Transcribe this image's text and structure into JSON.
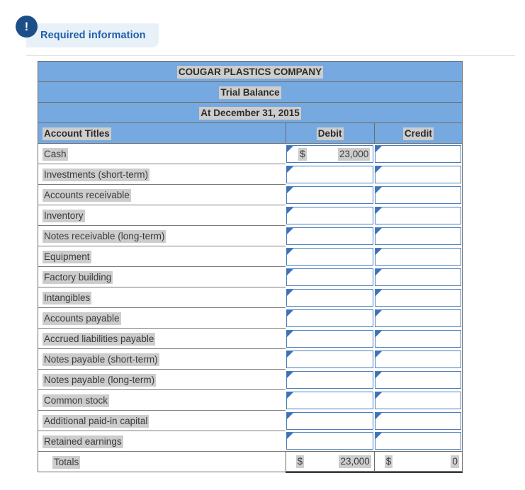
{
  "banner": {
    "icon": "exclamation-icon",
    "label": "Required information",
    "bg_color": "#e9f1f8",
    "text_color": "#1f5fa9",
    "icon_color": "#1c4e88"
  },
  "table": {
    "header_bg": "#76a9e0",
    "title_lines": [
      "COUGAR PLASTICS COMPANY",
      "Trial Balance",
      "At December 31, 2015"
    ],
    "columns": [
      "Account Titles",
      "Debit",
      "Credit"
    ],
    "rows": [
      {
        "account": "Cash",
        "debit_currency": "$",
        "debit": "23,000",
        "credit_currency": "",
        "credit": ""
      },
      {
        "account": "Investments (short-term)",
        "debit_currency": "",
        "debit": "",
        "credit_currency": "",
        "credit": ""
      },
      {
        "account": "Accounts receivable",
        "debit_currency": "",
        "debit": "",
        "credit_currency": "",
        "credit": ""
      },
      {
        "account": "Inventory",
        "debit_currency": "",
        "debit": "",
        "credit_currency": "",
        "credit": ""
      },
      {
        "account": "Notes receivable (long-term)",
        "debit_currency": "",
        "debit": "",
        "credit_currency": "",
        "credit": ""
      },
      {
        "account": "Equipment",
        "debit_currency": "",
        "debit": "",
        "credit_currency": "",
        "credit": ""
      },
      {
        "account": "Factory building",
        "debit_currency": "",
        "debit": "",
        "credit_currency": "",
        "credit": ""
      },
      {
        "account": "Intangibles",
        "debit_currency": "",
        "debit": "",
        "credit_currency": "",
        "credit": ""
      },
      {
        "account": "Accounts payable",
        "debit_currency": "",
        "debit": "",
        "credit_currency": "",
        "credit": ""
      },
      {
        "account": "Accrued liabilities payable",
        "debit_currency": "",
        "debit": "",
        "credit_currency": "",
        "credit": ""
      },
      {
        "account": "Notes payable (short-term)",
        "debit_currency": "",
        "debit": "",
        "credit_currency": "",
        "credit": ""
      },
      {
        "account": "Notes payable (long-term)",
        "debit_currency": "",
        "debit": "",
        "credit_currency": "",
        "credit": ""
      },
      {
        "account": "Common stock",
        "debit_currency": "",
        "debit": "",
        "credit_currency": "",
        "credit": ""
      },
      {
        "account": "Additional paid-in capital",
        "debit_currency": "",
        "debit": "",
        "credit_currency": "",
        "credit": ""
      },
      {
        "account": "Retained earnings",
        "debit_currency": "",
        "debit": "",
        "credit_currency": "",
        "credit": ""
      }
    ],
    "totals": {
      "label": "Totals",
      "debit_currency": "$",
      "debit": "23,000",
      "credit_currency": "$",
      "credit": "0"
    }
  }
}
